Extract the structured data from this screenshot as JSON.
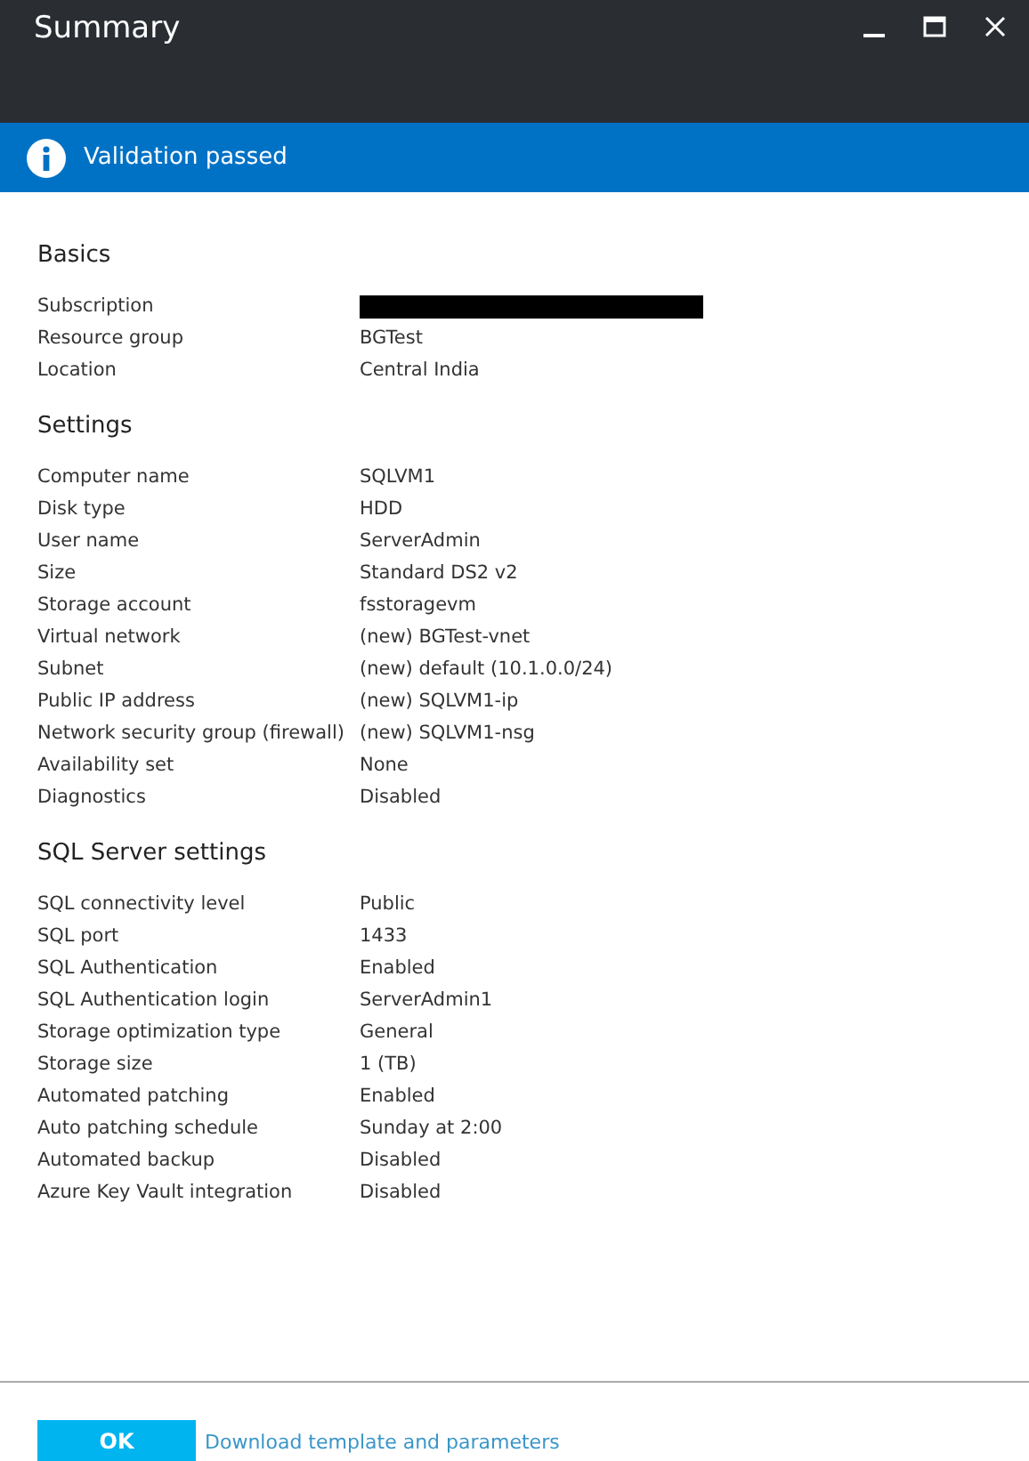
{
  "window": {
    "title": "Summary"
  },
  "banner": {
    "kind": "success",
    "text": "Validation passed"
  },
  "sections": [
    {
      "title": "Basics",
      "rows": [
        {
          "label": "Subscription",
          "redacted": true
        },
        {
          "label": "Resource group",
          "value": "BGTest",
          "redacted": false
        },
        {
          "label": "Location",
          "value": "Central India",
          "redacted": false
        }
      ]
    },
    {
      "title": "Settings",
      "rows": [
        {
          "label": "Computer name",
          "value": "SQLVM1",
          "redacted": false
        },
        {
          "label": "Disk type",
          "value": "HDD",
          "redacted": false
        },
        {
          "label": "User name",
          "value": "ServerAdmin",
          "redacted": false
        },
        {
          "label": "Size",
          "value": "Standard DS2 v2",
          "redacted": false
        },
        {
          "label": "Storage account",
          "value": "fsstoragevm",
          "redacted": false
        },
        {
          "label": "Virtual network",
          "value": "(new) BGTest-vnet",
          "redacted": false
        },
        {
          "label": "Subnet",
          "value": "(new) default (10.1.0.0/24)",
          "redacted": false
        },
        {
          "label": "Public IP address",
          "value": "(new) SQLVM1-ip",
          "redacted": false
        },
        {
          "label": "Network security group (firewall)",
          "value": "(new) SQLVM1-nsg",
          "redacted": false
        },
        {
          "label": "Availability set",
          "value": "None",
          "redacted": false
        },
        {
          "label": "Diagnostics",
          "value": "Disabled",
          "redacted": false
        }
      ]
    },
    {
      "title": "SQL Server settings",
      "rows": [
        {
          "label": "SQL connectivity level",
          "value": "Public",
          "redacted": false
        },
        {
          "label": "SQL port",
          "value": "1433",
          "redacted": false
        },
        {
          "label": "SQL Authentication",
          "value": "Enabled",
          "redacted": false
        },
        {
          "label": "SQL Authentication login",
          "value": "ServerAdmin1",
          "redacted": false
        },
        {
          "label": "Storage optimization type",
          "value": "General",
          "redacted": false
        },
        {
          "label": "Storage size",
          "value": "1 (TB)",
          "redacted": false
        },
        {
          "label": "Automated patching",
          "value": "Enabled",
          "redacted": false
        },
        {
          "label": "Auto patching schedule",
          "value": "Sunday at 2:00",
          "redacted": false
        },
        {
          "label": "Automated backup",
          "value": "Disabled",
          "redacted": false
        },
        {
          "label": "Azure Key Vault integration",
          "value": "Disabled",
          "redacted": false
        }
      ]
    }
  ],
  "footer": {
    "ok_button": "OK",
    "link": "Download template and parameters"
  }
}
